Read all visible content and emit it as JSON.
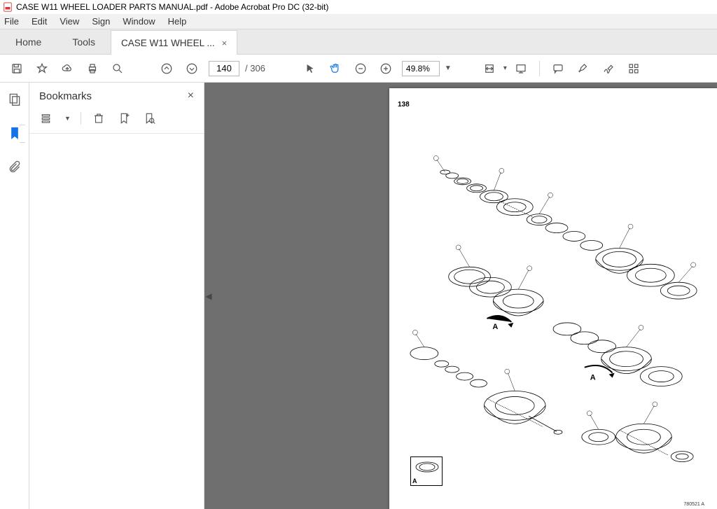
{
  "window": {
    "title": "CASE W11 WHEEL LOADER PARTS MANUAL.pdf - Adobe Acrobat Pro DC (32-bit)"
  },
  "menu": {
    "file": "File",
    "edit": "Edit",
    "view": "View",
    "sign": "Sign",
    "window": "Window",
    "help": "Help"
  },
  "tabs": {
    "home": "Home",
    "tools": "Tools",
    "doc_label": "CASE W11 WHEEL ...",
    "close": "×"
  },
  "toolbar": {
    "page_current": "140",
    "page_total": "/ 306",
    "zoom": "49.8%"
  },
  "bookmarks": {
    "title": "Bookmarks",
    "close": "×"
  },
  "page": {
    "number": "138",
    "ref": "780521 A",
    "detail_label": "A"
  }
}
